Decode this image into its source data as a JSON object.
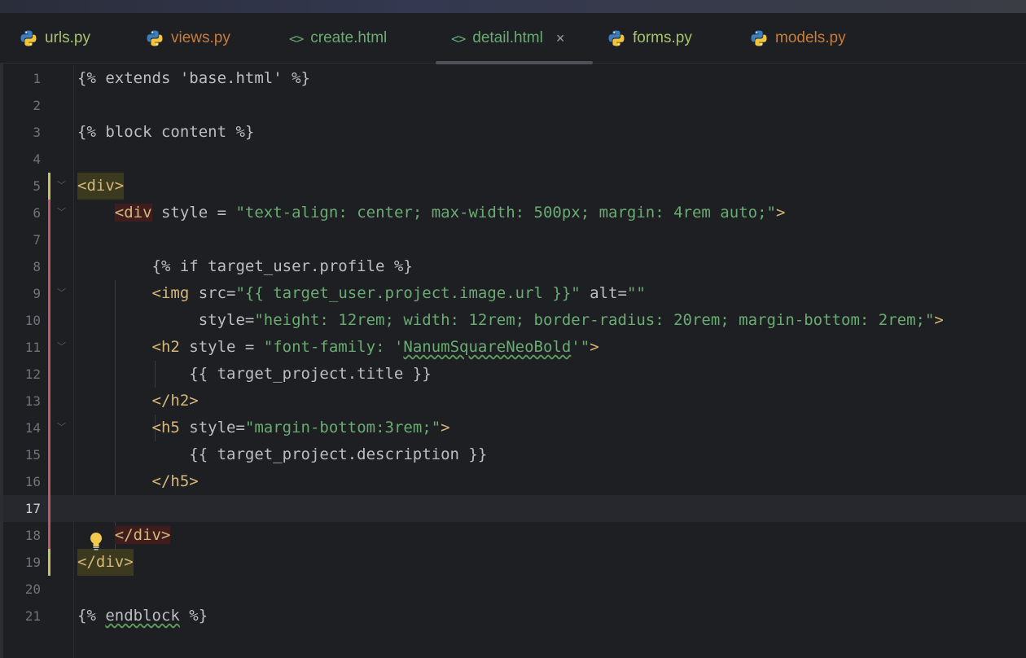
{
  "tabs": [
    {
      "label": "urls.py",
      "type": "python",
      "color": "#a8c26e"
    },
    {
      "label": "views.py",
      "type": "python",
      "color": "#c77c3a"
    },
    {
      "label": "create.html",
      "type": "html",
      "color": "#6aab73"
    },
    {
      "label": "detail.html",
      "type": "html",
      "color": "#6aab73",
      "active": true,
      "close": "×"
    },
    {
      "label": "forms.py",
      "type": "python",
      "color": "#a8c26e"
    },
    {
      "label": "models.py",
      "type": "python",
      "color": "#c77c3a"
    }
  ],
  "html_icon": "<>",
  "icons": {
    "python": "python-file-icon",
    "html": "html-file-icon",
    "bulb": "lightbulb-icon",
    "fold": "fold-arrow-icon"
  },
  "editor": {
    "current_line": 17,
    "lines": [
      "{% extends 'base.html' %}",
      "",
      "{% block content %}",
      "",
      "<div>",
      "    <div style = \"text-align: center; max-width: 500px; margin: 4rem auto;\">",
      "",
      "        {% if target_user.profile %}",
      "        <img src=\"{{ target_user.project.image.url }}\" alt=\"\"",
      "             style=\"height: 12rem; width: 12rem; border-radius: 20rem; margin-bottom: 2rem;\">",
      "        <h2 style = \"font-family: 'NanumSquareNeoBold'\">",
      "            {{ target_project.title }}",
      "        </h2>",
      "        <h5 style=\"margin-bottom:3rem;\">",
      "            {{ target_project.description }}",
      "        </h5>",
      "",
      "    </div>",
      "</div>",
      "",
      "{% endblock %}"
    ]
  },
  "colors": {
    "tag": "#d5b778",
    "string": "#6aab73",
    "text": "#bcbec4",
    "background": "#1e1f22"
  }
}
